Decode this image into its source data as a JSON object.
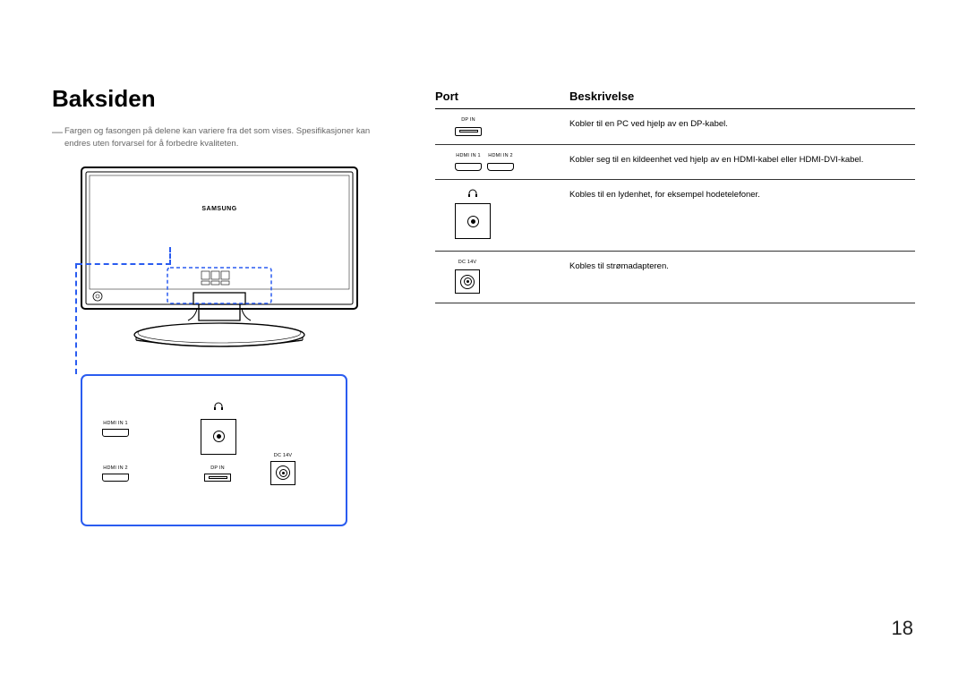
{
  "title": "Baksiden",
  "disclaimer": "Fargen og fasongen på delene kan variere fra det som vises. Spesifikasjoner kan endres uten forvarsel for å forbedre kvaliteten.",
  "brand": "SAMSUNG",
  "legend": {
    "hdmi_in_1": "HDMI IN 1",
    "hdmi_in_2": "HDMI IN 2",
    "dp_in": "DP IN",
    "dc_14v": "DC 14V",
    "headphone": "♫"
  },
  "table": {
    "header_port": "Port",
    "header_desc": "Beskrivelse",
    "rows": [
      {
        "port_labels": [
          "DP IN"
        ],
        "desc": "Kobler til en PC ved hjelp av en DP-kabel."
      },
      {
        "port_labels": [
          "HDMI IN 1",
          "HDMI IN 2"
        ],
        "desc": "Kobler seg til en kildeenhet ved hjelp av en HDMI-kabel eller HDMI-DVI-kabel."
      },
      {
        "port_labels": [],
        "desc": "Kobles til en lydenhet, for eksempel hodetelefoner."
      },
      {
        "port_labels": [
          "DC 14V"
        ],
        "desc": "Kobles til strømadapteren."
      }
    ]
  },
  "page_number": "18"
}
